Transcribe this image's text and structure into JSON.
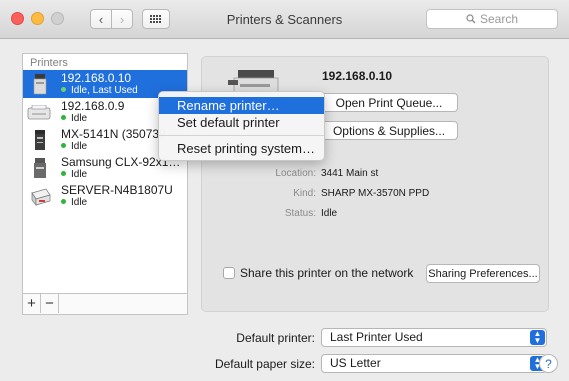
{
  "window": {
    "title": "Printers & Scanners"
  },
  "toolbar": {
    "back": "‹",
    "forward": "›",
    "search_placeholder": "Search"
  },
  "printers": {
    "header": "Printers",
    "items": [
      {
        "name": "192.168.0.10",
        "status": "Idle, Last Used",
        "selected": true
      },
      {
        "name": "192.168.0.9",
        "status": "Idle"
      },
      {
        "name": "MX-5141N (350739",
        "status": "Idle"
      },
      {
        "name": "Samsung CLX-92x1…",
        "status": "Idle"
      },
      {
        "name": "SERVER-N4B1807U",
        "status": "Idle"
      }
    ],
    "add_label": "+",
    "remove_label": "−"
  },
  "context_menu": {
    "items": [
      {
        "label": "Rename printer…",
        "highlighted": true
      },
      {
        "label": "Set default printer"
      },
      {
        "label": "Reset printing system…"
      }
    ]
  },
  "detail": {
    "name": "192.168.0.10",
    "open_queue_label": "Open Print Queue...",
    "options_label": "Options & Supplies...",
    "location_label": "Location:",
    "location_value": "3441 Main st",
    "kind_label": "Kind:",
    "kind_value": "SHARP MX-3570N PPD",
    "status_label": "Status:",
    "status_value": "Idle",
    "share_label": "Share this printer on the network",
    "sharing_prefs_label": "Sharing Preferences..."
  },
  "bottom": {
    "default_printer_label": "Default printer:",
    "default_printer_value": "Last Printer Used",
    "paper_size_label": "Default paper size:",
    "paper_size_value": "US Letter",
    "help_label": "?"
  },
  "colors": {
    "accent": "#1f6fdc",
    "idle_dot": "#2fb33b"
  }
}
